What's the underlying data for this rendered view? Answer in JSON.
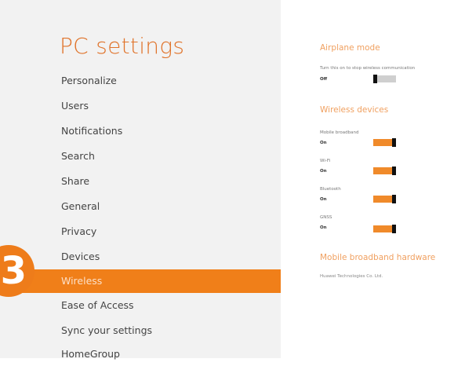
{
  "sidebar": {
    "title": "PC settings",
    "items": [
      {
        "label": "Personalize"
      },
      {
        "label": "Users"
      },
      {
        "label": "Notifications"
      },
      {
        "label": "Search"
      },
      {
        "label": "Share"
      },
      {
        "label": "General"
      },
      {
        "label": "Privacy"
      },
      {
        "label": "Devices"
      },
      {
        "label": "Wireless",
        "selected": true
      },
      {
        "label": "Ease of Access"
      },
      {
        "label": "Sync your settings"
      },
      {
        "label": "HomeGroup"
      }
    ]
  },
  "step_badge": "3",
  "airplane": {
    "heading": "Airplane mode",
    "description": "Turn this on to stop wireless communication",
    "state": "Off"
  },
  "wireless_devices": {
    "heading": "Wireless devices",
    "devices": [
      {
        "name": "Mobile broadband",
        "state": "On"
      },
      {
        "name": "Wi-Fi",
        "state": "On"
      },
      {
        "name": "Bluetooth",
        "state": "On"
      },
      {
        "name": "GNSS",
        "state": "On"
      }
    ]
  },
  "hardware": {
    "heading": "Mobile broadband hardware",
    "name": "Huawei Technologies Co. Ltd."
  },
  "colors": {
    "accent": "#f07f19",
    "title": "#e0732a",
    "heading": "#f0a060"
  }
}
